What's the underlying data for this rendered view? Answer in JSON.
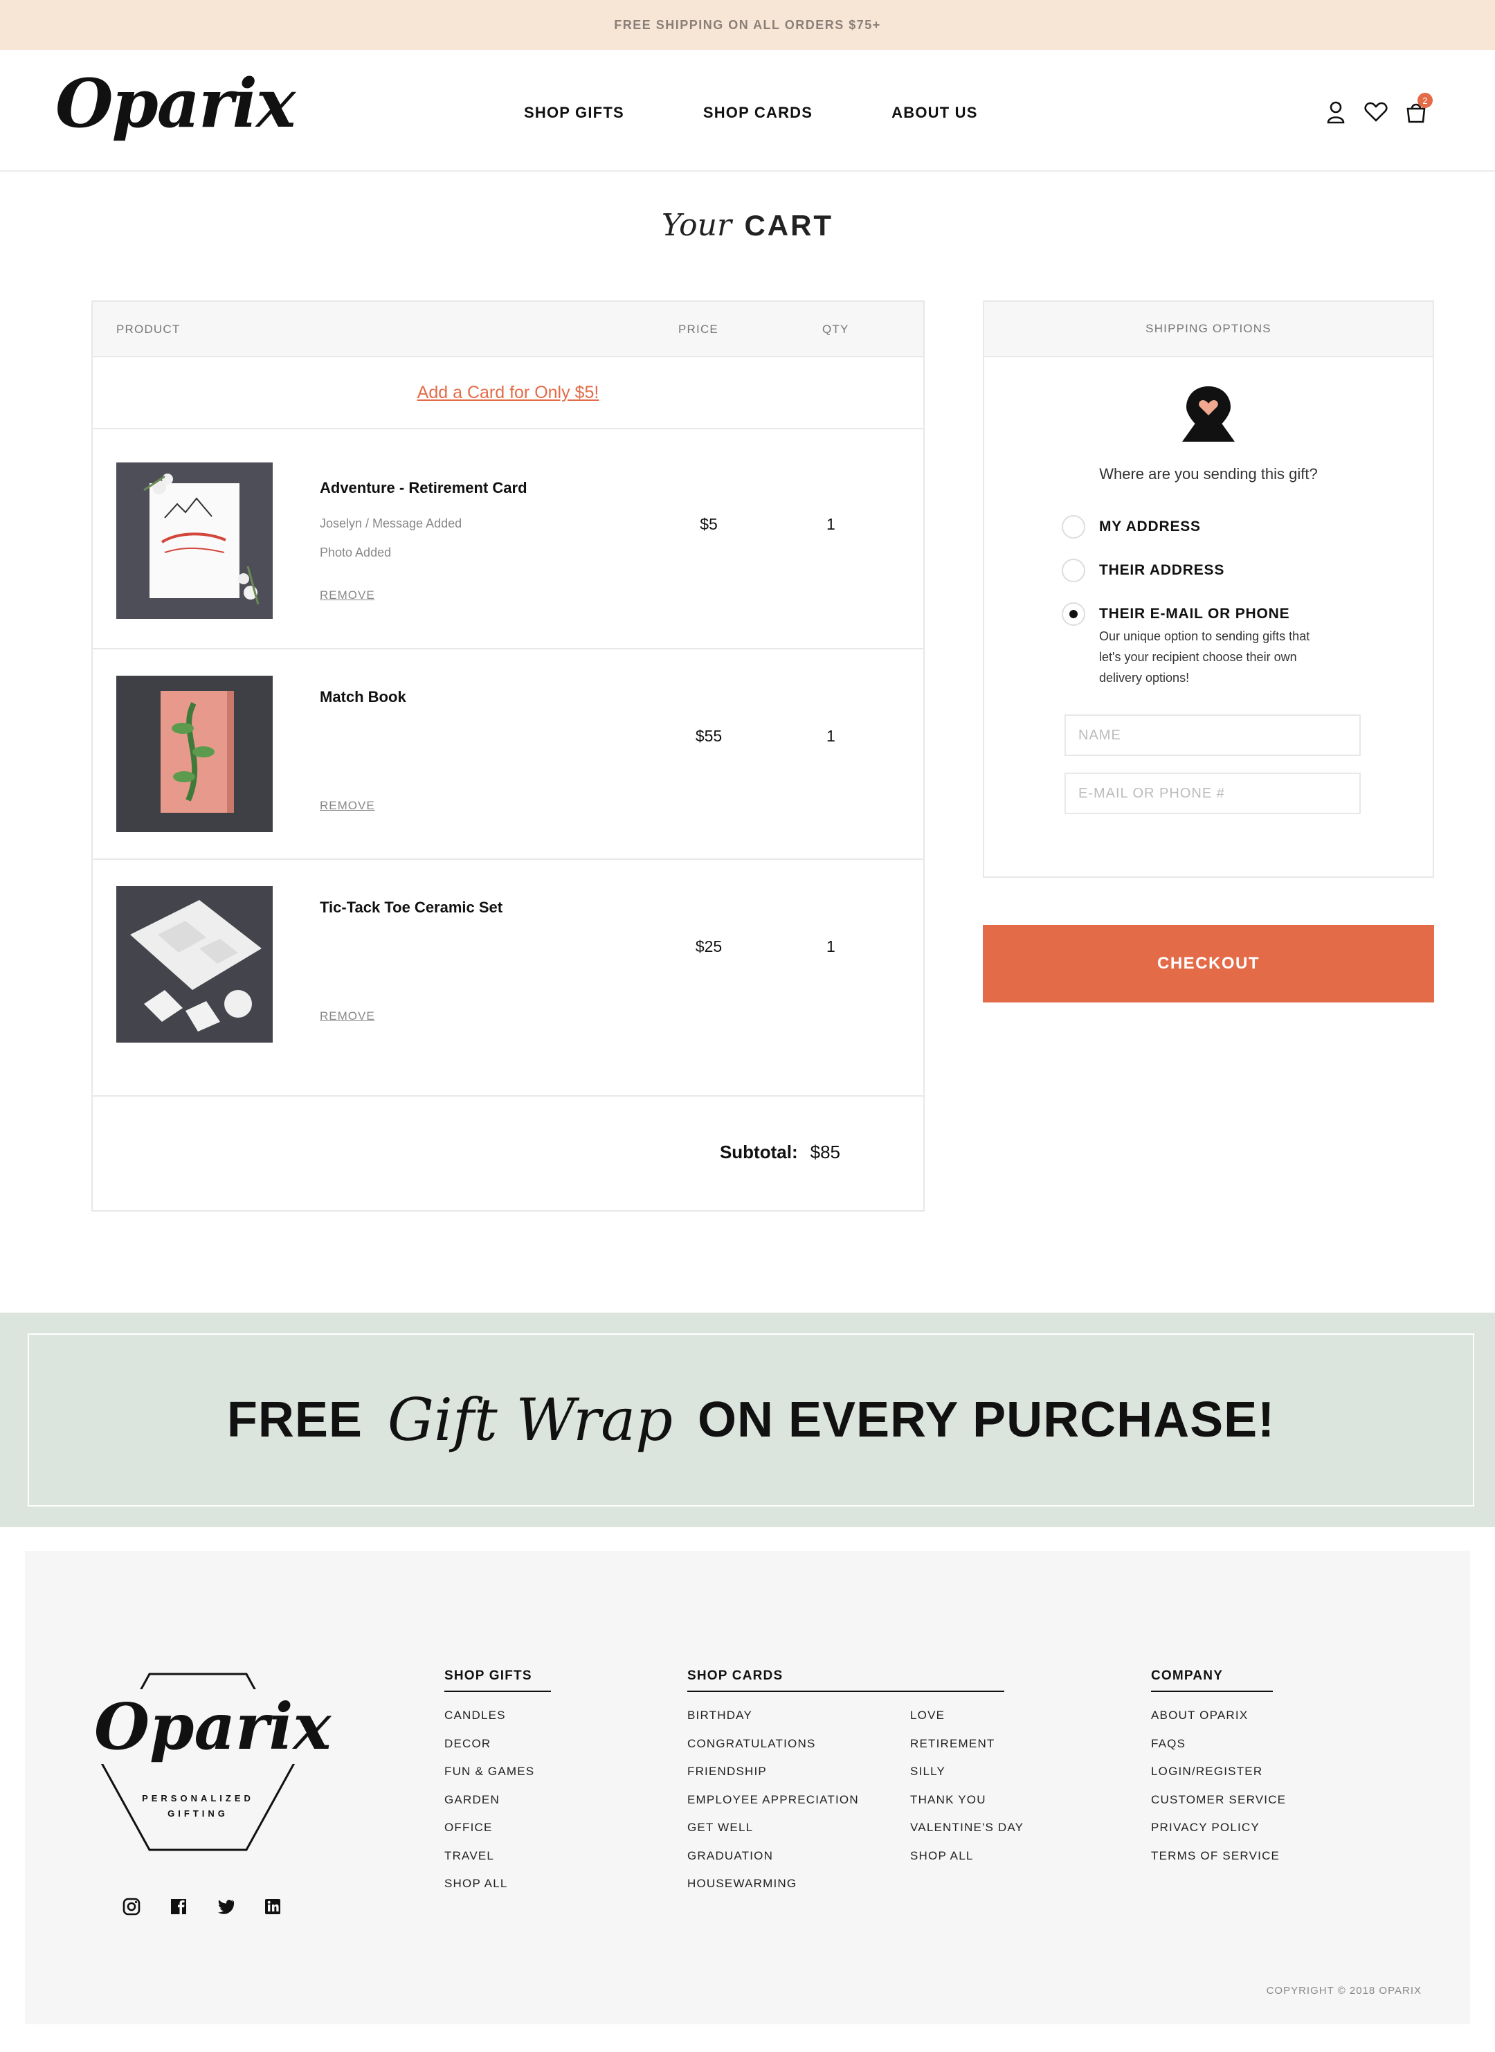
{
  "announcement": "FREE SHIPPING ON ALL ORDERS $75+",
  "brand": {
    "logo": "Oparix",
    "tagline_1": "PERSONALIZED",
    "tagline_2": "GIFTING"
  },
  "nav": {
    "items": [
      "SHOP GIFTS",
      "SHOP CARDS",
      "ABOUT US"
    ]
  },
  "header_icons": {
    "account": "user-icon",
    "wishlist": "heart-icon",
    "cart": "shopping-bag-icon",
    "cart_count": "2"
  },
  "page_title": {
    "script": "Your",
    "bold": "CART"
  },
  "cart": {
    "columns": {
      "product": "PRODUCT",
      "price": "PRICE",
      "qty": "QTY"
    },
    "add_card": "Add a Card for Only $5!",
    "items": [
      {
        "name": "Adventure - Retirement Card",
        "detail_1": "Joselyn / Message Added",
        "detail_2": "Photo Added",
        "price": "$5",
        "qty": "1",
        "remove": "REMOVE"
      },
      {
        "name": "Match Book",
        "price": "$55",
        "qty": "1",
        "remove": "REMOVE"
      },
      {
        "name": "Tic-Tack Toe Ceramic Set",
        "price": "$25",
        "qty": "1",
        "remove": "REMOVE"
      }
    ],
    "subtotal_label": "Subtotal:",
    "subtotal_value": "$85"
  },
  "shipping": {
    "title": "SHIPPING OPTIONS",
    "question": "Where are you sending this gift?",
    "options": [
      {
        "label": "MY ADDRESS",
        "selected": false
      },
      {
        "label": "THEIR ADDRESS",
        "selected": false
      },
      {
        "label": "THEIR E-MAIL OR PHONE",
        "selected": true
      }
    ],
    "description": "Our unique option to sending gifts that let's your recipient choose their own delivery options!",
    "name_placeholder": "NAME",
    "contact_placeholder": "E-MAIL OR PHONE #",
    "checkout": "CHECKOUT"
  },
  "promo": {
    "left": "FREE",
    "script": "Gift Wrap",
    "right": "ON EVERY PURCHASE!"
  },
  "footer": {
    "shop_gifts": {
      "title": "SHOP GIFTS",
      "links": [
        "CANDLES",
        "DECOR",
        "FUN & GAMES",
        "GARDEN",
        "OFFICE",
        "TRAVEL",
        "SHOP ALL"
      ]
    },
    "shop_cards": {
      "title": "SHOP CARDS",
      "links_a": [
        "BIRTHDAY",
        "CONGRATULATIONS",
        "FRIENDSHIP",
        "EMPLOYEE APPRECIATION",
        "GET WELL",
        "GRADUATION",
        "HOUSEWARMING"
      ],
      "links_b": [
        "LOVE",
        "RETIREMENT",
        "SILLY",
        "THANK YOU",
        "VALENTINE'S DAY",
        "SHOP ALL"
      ]
    },
    "company": {
      "title": "COMPANY",
      "links": [
        "ABOUT OPARIX",
        "FAQS",
        "LOGIN/REGISTER",
        "CUSTOMER SERVICE",
        "PRIVACY POLICY",
        "TERMS OF SERVICE"
      ]
    },
    "social": [
      "instagram-icon",
      "facebook-icon",
      "twitter-icon",
      "linkedin-icon"
    ],
    "copyright": "COPYRIGHT © 2018 OPARIX"
  },
  "colors": {
    "accent": "#e36b48",
    "announcement_bg": "#f7e6d6",
    "promo_bg": "#dbe5dd",
    "footer_bg": "#f6f6f6"
  }
}
